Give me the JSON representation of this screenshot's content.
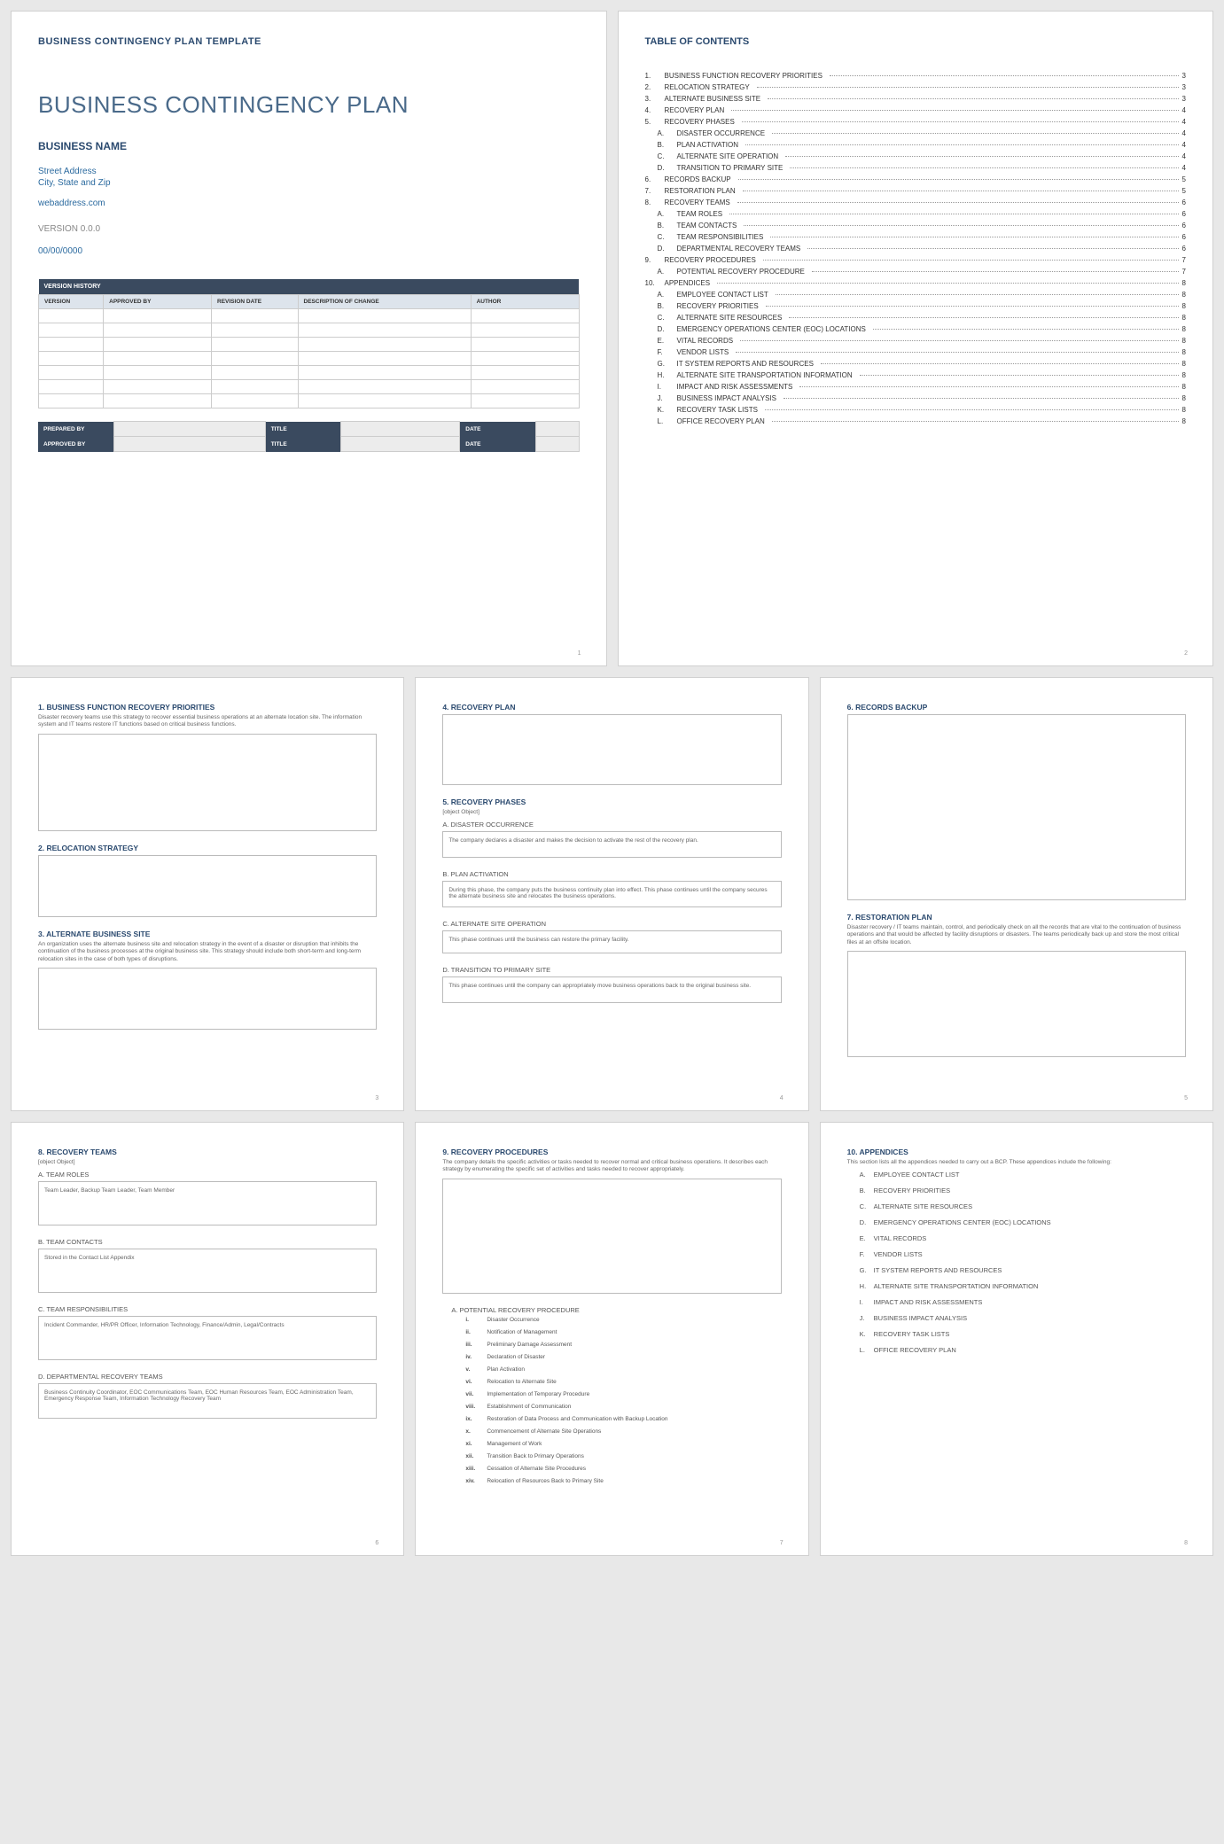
{
  "cover": {
    "label": "BUSINESS CONTINGENCY PLAN TEMPLATE",
    "title": "BUSINESS CONTINGENCY PLAN",
    "bizname": "BUSINESS NAME",
    "addr1": "Street Address",
    "addr2": "City, State and Zip",
    "web": "webaddress.com",
    "version": "VERSION 0.0.0",
    "date": "00/00/0000",
    "vh_header": "VERSION HISTORY",
    "vh_cols": [
      "VERSION",
      "APPROVED BY",
      "REVISION DATE",
      "DESCRIPTION OF CHANGE",
      "AUTHOR"
    ],
    "sig": {
      "prepared": "PREPARED BY",
      "approved": "APPROVED BY",
      "title": "TITLE",
      "date": "DATE"
    }
  },
  "toc": {
    "title": "TABLE OF CONTENTS",
    "items": [
      {
        "n": "1.",
        "t": "BUSINESS FUNCTION RECOVERY PRIORITIES",
        "p": "3"
      },
      {
        "n": "2.",
        "t": "RELOCATION STRATEGY",
        "p": "3"
      },
      {
        "n": "3.",
        "t": "ALTERNATE BUSINESS SITE",
        "p": "3"
      },
      {
        "n": "4.",
        "t": "RECOVERY PLAN",
        "p": "4"
      },
      {
        "n": "5.",
        "t": "RECOVERY PHASES",
        "p": "4"
      },
      {
        "n": "A.",
        "t": "DISASTER OCCURRENCE",
        "p": "4",
        "sub": true
      },
      {
        "n": "B.",
        "t": "PLAN ACTIVATION",
        "p": "4",
        "sub": true
      },
      {
        "n": "C.",
        "t": "ALTERNATE SITE OPERATION",
        "p": "4",
        "sub": true
      },
      {
        "n": "D.",
        "t": "TRANSITION TO PRIMARY SITE",
        "p": "4",
        "sub": true
      },
      {
        "n": "6.",
        "t": "RECORDS BACKUP",
        "p": "5"
      },
      {
        "n": "7.",
        "t": "RESTORATION PLAN",
        "p": "5"
      },
      {
        "n": "8.",
        "t": "RECOVERY TEAMS",
        "p": "6"
      },
      {
        "n": "A.",
        "t": "TEAM ROLES",
        "p": "6",
        "sub": true
      },
      {
        "n": "B.",
        "t": "TEAM CONTACTS",
        "p": "6",
        "sub": true
      },
      {
        "n": "C.",
        "t": "TEAM RESPONSIBILITIES",
        "p": "6",
        "sub": true
      },
      {
        "n": "D.",
        "t": "DEPARTMENTAL RECOVERY TEAMS",
        "p": "6",
        "sub": true
      },
      {
        "n": "9.",
        "t": "RECOVERY PROCEDURES",
        "p": "7"
      },
      {
        "n": "A.",
        "t": "POTENTIAL RECOVERY PROCEDURE",
        "p": "7",
        "sub": true
      },
      {
        "n": "10.",
        "t": "APPENDICES",
        "p": "8"
      },
      {
        "n": "A.",
        "t": "EMPLOYEE CONTACT LIST",
        "p": "8",
        "sub": true
      },
      {
        "n": "B.",
        "t": "RECOVERY PRIORITIES",
        "p": "8",
        "sub": true
      },
      {
        "n": "C.",
        "t": "ALTERNATE SITE RESOURCES",
        "p": "8",
        "sub": true
      },
      {
        "n": "D.",
        "t": "EMERGENCY OPERATIONS CENTER (EOC) LOCATIONS",
        "p": "8",
        "sub": true
      },
      {
        "n": "E.",
        "t": "VITAL RECORDS",
        "p": "8",
        "sub": true
      },
      {
        "n": "F.",
        "t": "VENDOR LISTS",
        "p": "8",
        "sub": true
      },
      {
        "n": "G.",
        "t": "IT SYSTEM REPORTS AND RESOURCES",
        "p": "8",
        "sub": true
      },
      {
        "n": "H.",
        "t": "ALTERNATE SITE TRANSPORTATION INFORMATION",
        "p": "8",
        "sub": true
      },
      {
        "n": "I.",
        "t": "IMPACT AND RISK ASSESSMENTS",
        "p": "8",
        "sub": true
      },
      {
        "n": "J.",
        "t": "BUSINESS IMPACT ANALYSIS",
        "p": "8",
        "sub": true
      },
      {
        "n": "K.",
        "t": "RECOVERY TASK LISTS",
        "p": "8",
        "sub": true
      },
      {
        "n": "L.",
        "t": "OFFICE RECOVERY PLAN",
        "p": "8",
        "sub": true
      }
    ]
  },
  "p3": {
    "s1": {
      "h": "1. BUSINESS FUNCTION RECOVERY PRIORITIES",
      "d": "Disaster recovery teams use this strategy to recover essential business operations at an alternate location site. The information system and IT teams restore IT functions based on critical business functions."
    },
    "s2": {
      "h": "2. RELOCATION STRATEGY"
    },
    "s3": {
      "h": "3. ALTERNATE BUSINESS SITE",
      "d": "An organization uses the alternate business site and relocation strategy in the event of a disaster or disruption that inhibits the continuation of the business processes at the original business site. This strategy should include both short-term and long-term relocation sites in the case of both types of disruptions."
    }
  },
  "p4": {
    "s4": {
      "h": "4. RECOVERY PLAN"
    },
    "s5": {
      "h": "5. RECOVERY PHASES",
      "d": {
        "h": "D. TRANSITION TO PRIMARY SITE",
        "b": "This phase continues until the company can appropriately move business operations back to the original business site."
      },
      "a": {
        "h": "A. DISASTER OCCURRENCE",
        "b": "The company declares a disaster and makes the decision to activate the rest of the recovery plan."
      },
      "b": {
        "h": "B. PLAN ACTIVATION",
        "b": "During this phase, the company puts the business continuity plan into effect. This phase continues until the company secures the alternate business site and relocates the business operations."
      },
      "c": {
        "h": "C. ALTERNATE SITE OPERATION",
        "b": "This phase continues until the business can restore the primary facility."
      }
    }
  },
  "p5": {
    "s6": {
      "h": "6. RECORDS BACKUP"
    },
    "s7": {
      "h": "7. RESTORATION PLAN",
      "d": "Disaster recovery / IT teams maintain, control, and periodically check on all the records that are vital to the continuation of business operations and that would be affected by facility disruptions or disasters. The teams periodically back up and store the most critical files at an offsite location."
    }
  },
  "p6": {
    "s8": {
      "h": "8. RECOVERY TEAMS",
      "d": {
        "h": "D. DEPARTMENTAL RECOVERY TEAMS",
        "b": "Business Continuity Coordinator, EOC Communications Team, EOC Human Resources Team, EOC Administration Team, Emergency Response Team, Information Technology Recovery Team"
      },
      "a": {
        "h": "A. TEAM ROLES",
        "b": "Team Leader, Backup Team Leader, Team Member"
      },
      "b": {
        "h": "B. TEAM CONTACTS",
        "b": "Stored in the Contact List Appendix"
      },
      "c": {
        "h": "C. TEAM RESPONSIBILITIES",
        "b": "Incident Commander, HR/PR Officer, Information Technology, Finance/Admin, Legal/Contracts"
      }
    }
  },
  "p7": {
    "s9": {
      "h": "9. RECOVERY PROCEDURES",
      "d": "The company details the specific activities or tasks needed to recover normal and critical business operations. It describes each strategy by enumerating the specific set of activities and tasks needed to recover appropriately.",
      "a": {
        "h": "A. POTENTIAL RECOVERY PROCEDURE",
        "steps": [
          {
            "rn": "i.",
            "t": "Disaster Occurrence"
          },
          {
            "rn": "ii.",
            "t": "Notification of Management"
          },
          {
            "rn": "iii.",
            "t": "Preliminary Damage Assessment"
          },
          {
            "rn": "iv.",
            "t": "Declaration of Disaster"
          },
          {
            "rn": "v.",
            "t": "Plan Activation"
          },
          {
            "rn": "vi.",
            "t": "Relocation to Alternate Site"
          },
          {
            "rn": "vii.",
            "t": "Implementation of Temporary Procedure"
          },
          {
            "rn": "viii.",
            "t": "Establishment of Communication"
          },
          {
            "rn": "ix.",
            "t": "Restoration of Data Process and Communication with Backup Location"
          },
          {
            "rn": "x.",
            "t": "Commencement of Alternate Site Operations"
          },
          {
            "rn": "xi.",
            "t": "Management of Work"
          },
          {
            "rn": "xii.",
            "t": "Transition Back to Primary Operations"
          },
          {
            "rn": "xiii.",
            "t": "Cessation of Alternate Site Procedures"
          },
          {
            "rn": "xiv.",
            "t": "Relocation of Resources Back to Primary Site"
          }
        ]
      }
    }
  },
  "p8": {
    "s10": {
      "h": "10.   APPENDICES",
      "d": "This section lists all the appendices needed to carry out a BCP. These appendices include the following:",
      "items": [
        {
          "l": "A.",
          "t": "EMPLOYEE CONTACT LIST"
        },
        {
          "l": "B.",
          "t": "RECOVERY PRIORITIES"
        },
        {
          "l": "C.",
          "t": "ALTERNATE SITE RESOURCES"
        },
        {
          "l": "D.",
          "t": "EMERGENCY OPERATIONS CENTER (EOC) LOCATIONS"
        },
        {
          "l": "E.",
          "t": "VITAL RECORDS"
        },
        {
          "l": "F.",
          "t": "VENDOR LISTS"
        },
        {
          "l": "G.",
          "t": "IT SYSTEM REPORTS AND RESOURCES"
        },
        {
          "l": "H.",
          "t": "ALTERNATE SITE TRANSPORTATION INFORMATION"
        },
        {
          "l": "I.",
          "t": "IMPACT AND RISK ASSESSMENTS"
        },
        {
          "l": "J.",
          "t": "BUSINESS IMPACT ANALYSIS"
        },
        {
          "l": "K.",
          "t": "RECOVERY TASK LISTS"
        },
        {
          "l": "L.",
          "t": "OFFICE RECOVERY PLAN"
        }
      ]
    }
  },
  "pgnums": {
    "p1": "1",
    "p2": "2",
    "p3": "3",
    "p4": "4",
    "p5": "5",
    "p6": "6",
    "p7": "7",
    "p8": "8"
  }
}
